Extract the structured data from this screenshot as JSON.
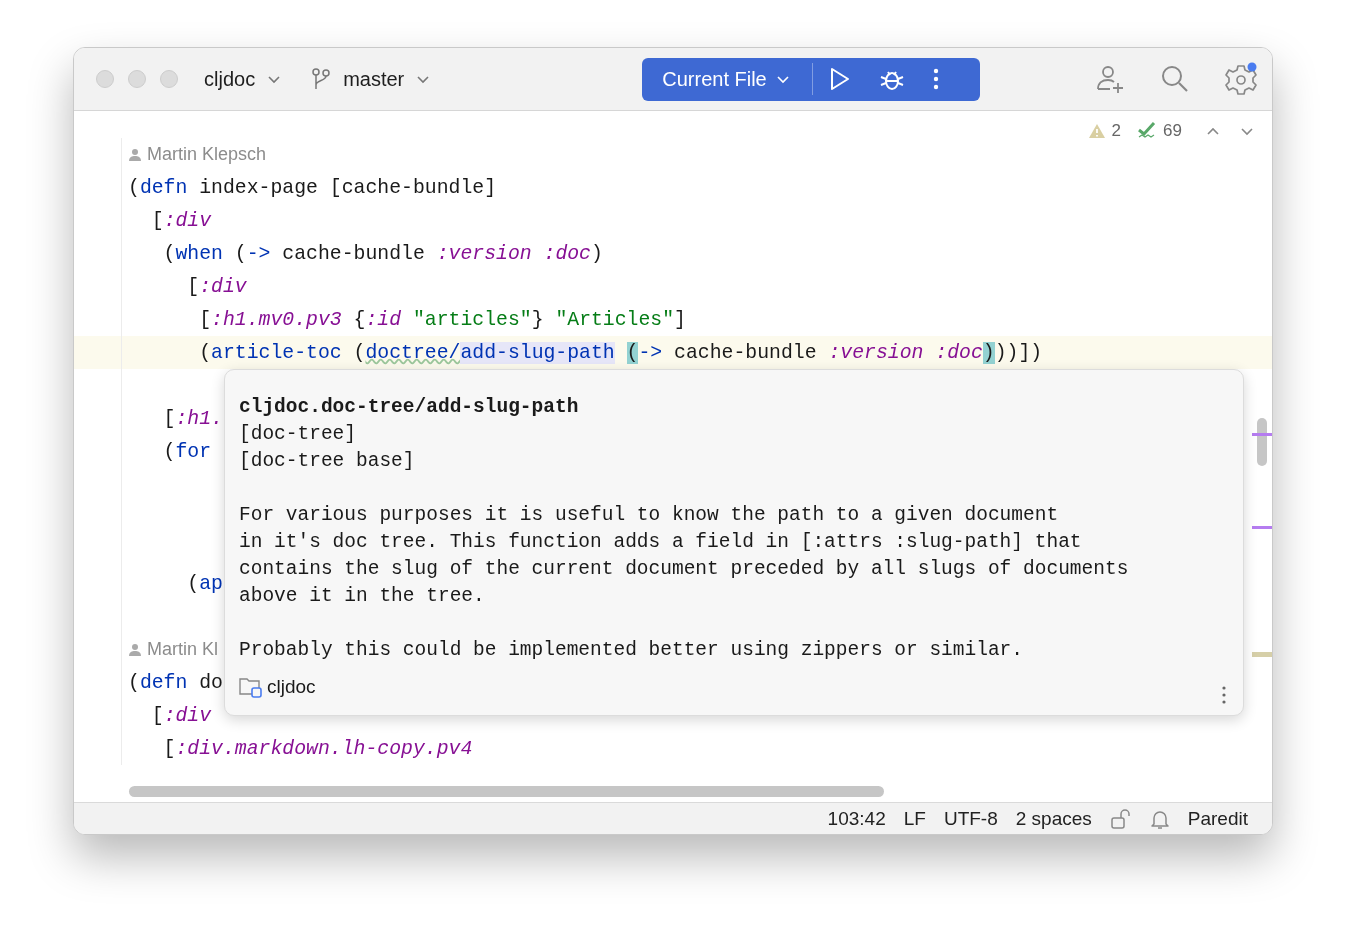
{
  "toolbar": {
    "project": "cljdoc",
    "branch": "master",
    "run_config": "Current File"
  },
  "inspections": {
    "warnings": "2",
    "passed": "69"
  },
  "editor": {
    "lines": [
      {
        "kind": "author",
        "current": false,
        "text": "Martin Klepsch"
      },
      {
        "kind": "code",
        "current": false,
        "tokens": [
          {
            "kind": "text",
            "text": "("
          },
          {
            "kind": "keyword",
            "text": "defn"
          },
          {
            "kind": "text",
            "text": " index-page [cache-bundle]"
          }
        ]
      },
      {
        "kind": "code",
        "current": false,
        "tokens": [
          {
            "kind": "text",
            "text": "  ["
          },
          {
            "kind": "key",
            "text": ":div"
          }
        ]
      },
      {
        "kind": "code",
        "current": false,
        "tokens": [
          {
            "kind": "text",
            "text": "   ("
          },
          {
            "kind": "keyword",
            "text": "when"
          },
          {
            "kind": "text",
            "text": " ("
          },
          {
            "kind": "keyword",
            "text": "->"
          },
          {
            "kind": "text",
            "text": " cache-bundle "
          },
          {
            "kind": "key",
            "text": ":version :doc"
          },
          {
            "kind": "text",
            "text": ")"
          }
        ]
      },
      {
        "kind": "code",
        "current": false,
        "tokens": [
          {
            "kind": "text",
            "text": "     ["
          },
          {
            "kind": "key",
            "text": ":div"
          }
        ]
      },
      {
        "kind": "code",
        "current": false,
        "tokens": [
          {
            "kind": "text",
            "text": "      ["
          },
          {
            "kind": "key",
            "text": ":h1.mv0.pv3"
          },
          {
            "kind": "text",
            "text": " {"
          },
          {
            "kind": "key",
            "text": ":id"
          },
          {
            "kind": "string",
            "text": " \"articles\""
          },
          {
            "kind": "text",
            "text": "} "
          },
          {
            "kind": "string",
            "text": "\"Articles\""
          },
          {
            "kind": "text",
            "text": "]"
          }
        ]
      },
      {
        "kind": "code",
        "current": true,
        "tokens": [
          {
            "kind": "text",
            "text": "      ("
          },
          {
            "kind": "keyword",
            "text": "article-toc"
          },
          {
            "kind": "text",
            "text": " ("
          },
          {
            "kind": "ns",
            "text": "doctree/"
          },
          {
            "kind": "ref",
            "text": "add-slug-path "
          },
          {
            "kind": "match",
            "text": "("
          },
          {
            "kind": "keyword",
            "text": "->"
          },
          {
            "kind": "text",
            "text": " cache-bundle "
          },
          {
            "kind": "key",
            "text": ":version :doc"
          },
          {
            "kind": "match",
            "text": ")"
          },
          {
            "kind": "text",
            "text": "))])"
          }
        ]
      },
      {
        "kind": "blank",
        "current": false
      },
      {
        "kind": "code",
        "current": false,
        "tokens": [
          {
            "kind": "text",
            "text": "   ["
          },
          {
            "kind": "key",
            "text": ":h1."
          }
        ]
      },
      {
        "kind": "code",
        "current": false,
        "tokens": [
          {
            "kind": "text",
            "text": "   ("
          },
          {
            "kind": "keyword",
            "text": "for"
          }
        ]
      },
      {
        "kind": "blank",
        "current": false
      },
      {
        "kind": "blank",
        "current": false
      },
      {
        "kind": "blank",
        "current": false
      },
      {
        "kind": "code",
        "current": false,
        "tokens": [
          {
            "kind": "text",
            "text": "     ("
          },
          {
            "kind": "keyword",
            "text": "ap"
          }
        ]
      },
      {
        "kind": "blank",
        "current": false
      },
      {
        "kind": "author",
        "current": false,
        "text": "Martin Kl"
      },
      {
        "kind": "code",
        "current": false,
        "tokens": [
          {
            "kind": "text",
            "text": "("
          },
          {
            "kind": "keyword",
            "text": "defn"
          },
          {
            "kind": "text",
            "text": " do"
          }
        ]
      },
      {
        "kind": "code",
        "current": false,
        "tokens": [
          {
            "kind": "text",
            "text": "  ["
          },
          {
            "kind": "key",
            "text": ":div"
          }
        ]
      },
      {
        "kind": "code",
        "current": false,
        "tokens": [
          {
            "kind": "text",
            "text": "   ["
          },
          {
            "kind": "key",
            "text": ":div.markdown.lh-copy.pv4"
          }
        ]
      }
    ]
  },
  "popup": {
    "title": "cljdoc.doc-tree/add-slug-path",
    "signatures": [
      "[doc-tree]",
      "[doc-tree base]"
    ],
    "paragraphs": [
      "For various purposes it is useful to know the path to a given document\nin it's doc tree. This function adds a field in [:attrs :slug-path] that\ncontains the slug of the current document preceded by all slugs of documents\nabove it in the tree.",
      "Probably this could be implemented better using zippers or similar."
    ],
    "module": "cljdoc"
  },
  "status_bar": {
    "items": [
      "103:42",
      "LF",
      "UTF-8",
      "2 spaces"
    ],
    "mode": "Paredit"
  }
}
